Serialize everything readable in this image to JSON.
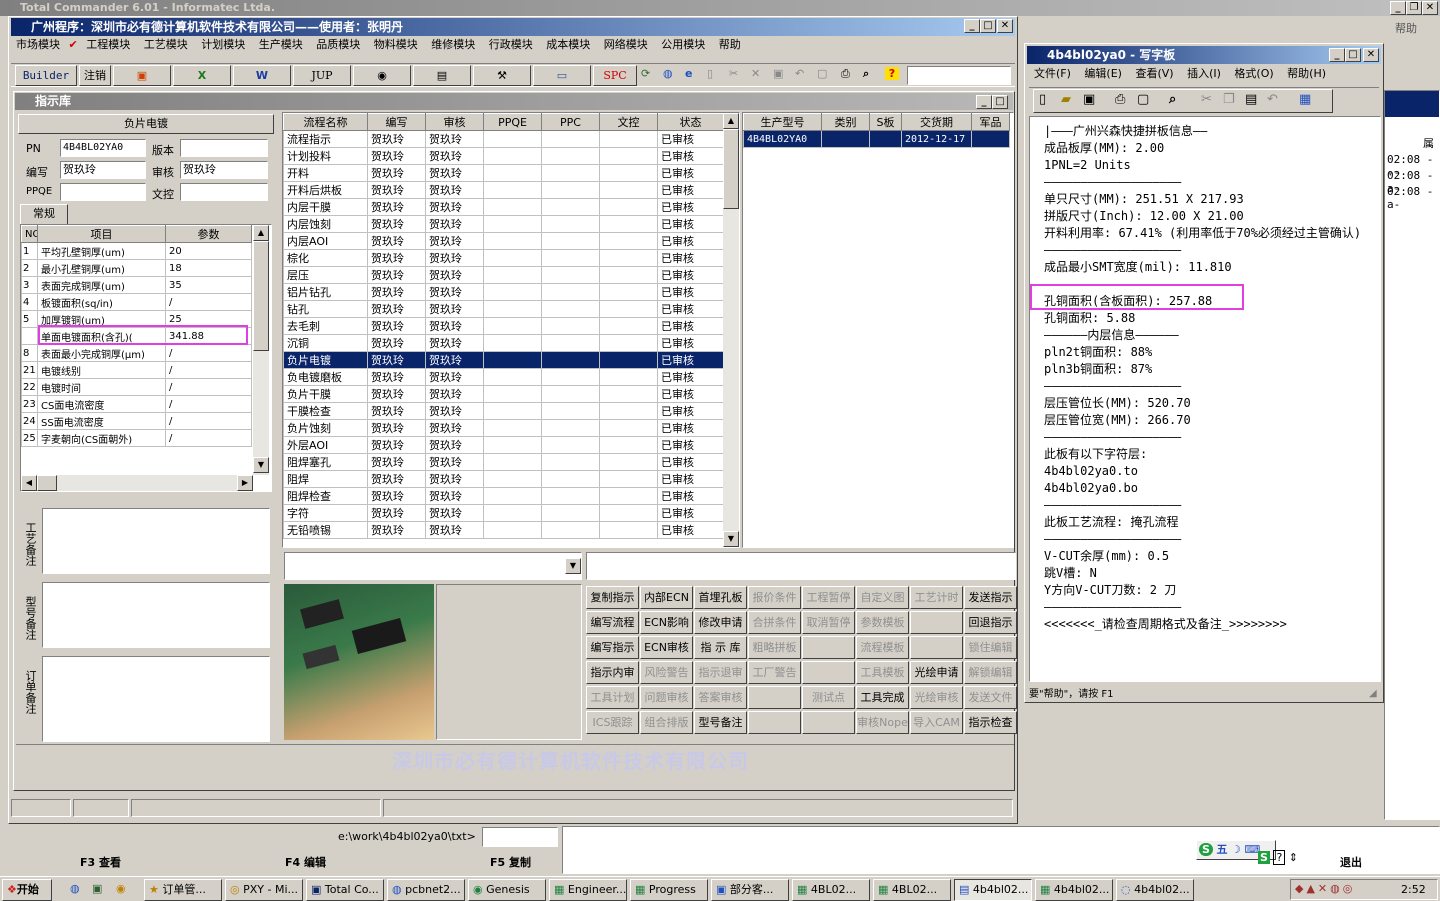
{
  "tc": {
    "title": "Total Commander 6.01 - Informatec Ltda.",
    "help_label": "帮助",
    "path": "e:\\work\\4b4bl02ya0\\txt>",
    "fkeys": [
      "F3 查看",
      "F4 编辑",
      "F5 复制"
    ],
    "exit_label": "退出",
    "times": [
      "02:08 ---",
      "02:08 -a-",
      "02:08 -a-"
    ],
    "col_label": "属"
  },
  "app": {
    "title": "广州程序：深圳市必有德计算机软件技术有限公司——使用者：张明丹",
    "menu": [
      "市场模块",
      "工程模块",
      "工艺模块",
      "计划模块",
      "生产模块",
      "品质模块",
      "物料模块",
      "维修模块",
      "行政模块",
      "成本模块",
      "网络模块",
      "公用模块",
      "帮助"
    ],
    "toolbar": [
      "Builder",
      "注销",
      "JUP",
      "SPC"
    ],
    "watermark": "深圳市必有德计算机软件技术有限公司"
  },
  "lib": {
    "title": "指示库",
    "group": "负片电镀",
    "pn_label": "PN",
    "pn": "4B4BL02YA0",
    "version_label": "版本",
    "version": "",
    "author_label": "编写",
    "author": "贺玖玲",
    "review_label": "审核",
    "review": "贺玖玲",
    "ppqe_label": "PPQE",
    "ppqe": "",
    "control_label": "文控",
    "control": "",
    "tab": "常规",
    "param_cols": [
      "NO",
      "项目",
      "参数"
    ],
    "params": [
      {
        "no": "1",
        "item": "平均孔壁铜厚(um)",
        "val": "20"
      },
      {
        "no": "2",
        "item": "最小孔壁铜厚(um)",
        "val": "18"
      },
      {
        "no": "3",
        "item": "表面完成铜厚(um)",
        "val": "35"
      },
      {
        "no": "4",
        "item": "板镀面积(sq/in)",
        "val": "/"
      },
      {
        "no": "5",
        "item": "加厚镀铜(um)",
        "val": "25"
      },
      {
        "no": "",
        "item": "单面电镀面积(含孔)(",
        "val": "341.88"
      },
      {
        "no": "8",
        "item": "表面最小完成铜厚(μm)",
        "val": "/"
      },
      {
        "no": "21",
        "item": "电镀线别",
        "val": "/"
      },
      {
        "no": "22",
        "item": "电镀时间",
        "val": "/"
      },
      {
        "no": "23",
        "item": "CS面电流密度",
        "val": "/"
      },
      {
        "no": "24",
        "item": "SS面电流密度",
        "val": "/"
      },
      {
        "no": "25",
        "item": "字麦朝向(CS面朝外)",
        "val": "/"
      }
    ],
    "side_labels": [
      "工艺备注",
      "型号备注",
      "订单备注"
    ]
  },
  "flow": {
    "cols": [
      "流程名称",
      "编写",
      "审核",
      "PPQE",
      "PPC",
      "文控",
      "状态"
    ],
    "author": "贺玖玲",
    "status": "已审核",
    "rows": [
      "流程指示",
      "计划投料",
      "开料",
      "开料后烘板",
      "内层干膜",
      "内层蚀刻",
      "内层AOI",
      "棕化",
      "层压",
      "铝片钻孔",
      "钻孔",
      "去毛刺",
      "沉铜",
      "负片电镀",
      "负电镀磨板",
      "负片干膜",
      "干膜检查",
      "负片蚀刻",
      "外层AOI",
      "阻焊塞孔",
      "阻焊",
      "阻焊检查",
      "字符",
      "无铅喷锡"
    ],
    "selected": 13
  },
  "orders": {
    "cols": [
      "生产型号",
      "类别",
      "S板",
      "交货期",
      "军品"
    ],
    "rows": [
      {
        "model": "4B4BL02YA0",
        "type": "",
        "s": "",
        "date": "2012-12-17",
        "mil": ""
      }
    ]
  },
  "buttons": [
    [
      "复制指示",
      "内部ECN",
      "首埋孔板",
      "报价条件",
      "工程暂停",
      "自定义图",
      "工艺计时",
      "发送指示"
    ],
    [
      "编写流程",
      "ECN影响",
      "修改申请",
      "合拼条件",
      "取消暂停",
      "参数模板",
      "",
      "回退指示"
    ],
    [
      "编写指示",
      "ECN审核",
      "指 示 库",
      "粗略拼板",
      "",
      "流程模板",
      "",
      "锁住编辑"
    ],
    [
      "指示内审",
      "风险警告",
      "指示退审",
      "工厂警告",
      "",
      "工具模板",
      "光绘申请",
      "解锁编辑"
    ],
    [
      "工具计划",
      "问题审核",
      "答案审核",
      "",
      "测试点",
      "工具完成",
      "光绘审核",
      "发送文件"
    ],
    [
      "ICS跟踪",
      "组合排版",
      "型号备注",
      "",
      "",
      "审核Nope",
      "导入CAM",
      "指示检查"
    ]
  ],
  "wordpad": {
    "title": "4b4bl02ya0 - 写字板",
    "menu": [
      "文件(F)",
      "编辑(E)",
      "查看(V)",
      "插入(I)",
      "格式(O)",
      "帮助(H)"
    ],
    "lines": [
      "|———广州兴森快捷拼板信息——",
      "成品板厚(MM): 2.00",
      "1PNL=2 Units",
      "———————————————————",
      "单只尺寸(MM): 251.51 X 217.93",
      "拼版尺寸(Inch): 12.00 X 21.00",
      "开料利用率: 67.41% (利用率低于70%必须经过主管确认)",
      "———————————————————",
      "成品最小SMT宽度(mil): 11.810",
      "———————————————————",
      "孔铜面积(含板面积): 257.88",
      "孔铜面积: 5.88",
      "——————内层信息——————",
      "pln2t铜面积: 88%",
      "pln3b铜面积: 87%",
      "———————————————————",
      "层压管位长(MM): 520.70",
      "层压管位宽(MM): 266.70",
      "———————————————————",
      "此板有以下字符层:",
      "4b4bl02ya0.to",
      "4b4bl02ya0.bo",
      "———————————————————",
      "此板工艺流程: 掩孔流程",
      "———————————————————",
      "V-CUT余厚(mm): 0.5",
      "跳V槽: N",
      "Y方向V-CUT刀数: 2 刀",
      "———————————————————",
      "<<<<<<<_请检查周期格式及备注_>>>>>>>>"
    ],
    "status": "要\"帮助\"，请按 F1"
  },
  "taskbar": {
    "start": "开始",
    "items": [
      "订单管...",
      "PXY - Mi...",
      "Total Co...",
      "pcbnet2...",
      "Genesis",
      "Engineer...",
      "Progress",
      "部分客...",
      "4BL02...",
      "4BL02...",
      "4b4bl02...",
      "4b4bl02...",
      "4b4bl02..."
    ],
    "active": 10,
    "clock": "2:52",
    "ime": "五"
  }
}
